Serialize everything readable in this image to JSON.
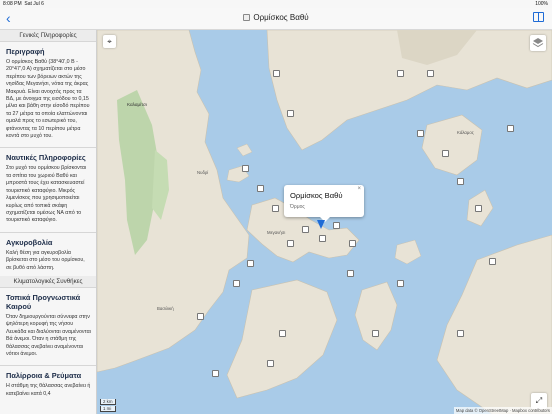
{
  "status_bar": {
    "time": "8:08 PM",
    "date": "Sat Jul 6",
    "battery": "100%"
  },
  "nav": {
    "back_icon": "chevron-left",
    "title": "Ορμίσκος Βαθύ",
    "book_icon": "book-icon"
  },
  "sidebar": {
    "general_header": "Γενικές Πληροφορίες",
    "description_title": "Περιγραφή",
    "description_text": "Ο ορμίσκος Βαθύ (38°40',0 Β - 20°47',0 Α) σχηματίζεται στο μέσο περίπου των βόρειων ακτών της νησίδας Μεγανήσι, νότια της άκρας Μακρυά. Είναι ανοιχτός προς τα ΒΔ, με άνοιγμα της εισόδου το 0,15 μίλια και βάθη στην είσοδό περίπου τα 27 μέτρα τα οποία ελαττώνονται ομαλά προς το εσωτερικό του, φτάνοντας τα 10 περίπου μέτρα κοντά στο μυχό του.",
    "nautical_title": "Ναυτικές Πληροφορίες",
    "nautical_text": "Στο μυχό του ορμίσκου βρίσκονται τα σπίτια του χωριού Βαθύ και μπροστά τους έχει κατασκευαστεί τουριστικό καταφύγιο. Μικρός λιμενίσκος που χρησιμοποιείται κυρίως από τοπικά σκάφη σχηματίζεται ομέσως ΝΑ από το τουριστικό καταφύγιο.",
    "anchorage_title": "Αγκυροβολία",
    "anchorage_text": "Καλή θέση για αγκυροβολία βρίσκεται στο μέσο του ορμίσκου, σε βυθό από λάσπη.",
    "climate_header": "Κλιματολογικές Συνθήκες",
    "local_weather_title": "Τοπικά Προγνωστικά Καιρού",
    "local_weather_text": "Όταν δημιουργούνται σύννεφα στην ψηλότερη κορυφή της νήσου Λευκάδα και διαλύονται αναμένονται Βά άνεμοι. Όταν η στάθμη της θάλασσας ανεβαίνει αναμένονται νότιοι άνεμοι.",
    "tides_title": "Παλίρροια & Ρεύματα",
    "tides_text": "Η στάθμη της θάλασσας ανεβαίνει ή κατεβαίνει κατά 0,4"
  },
  "map": {
    "popup": {
      "title": "Ορμίσκος Βαθύ",
      "subtitle": "Όρμος",
      "close": "×"
    },
    "scale_km": "2 km",
    "scale_mi": "1 mi",
    "attribution": "Map data © OpenStreetMap · Mapbox contributors",
    "locate_icon": "location-pin-icon",
    "layers_icon": "layers-icon",
    "expand_icon": "expand-icon"
  }
}
